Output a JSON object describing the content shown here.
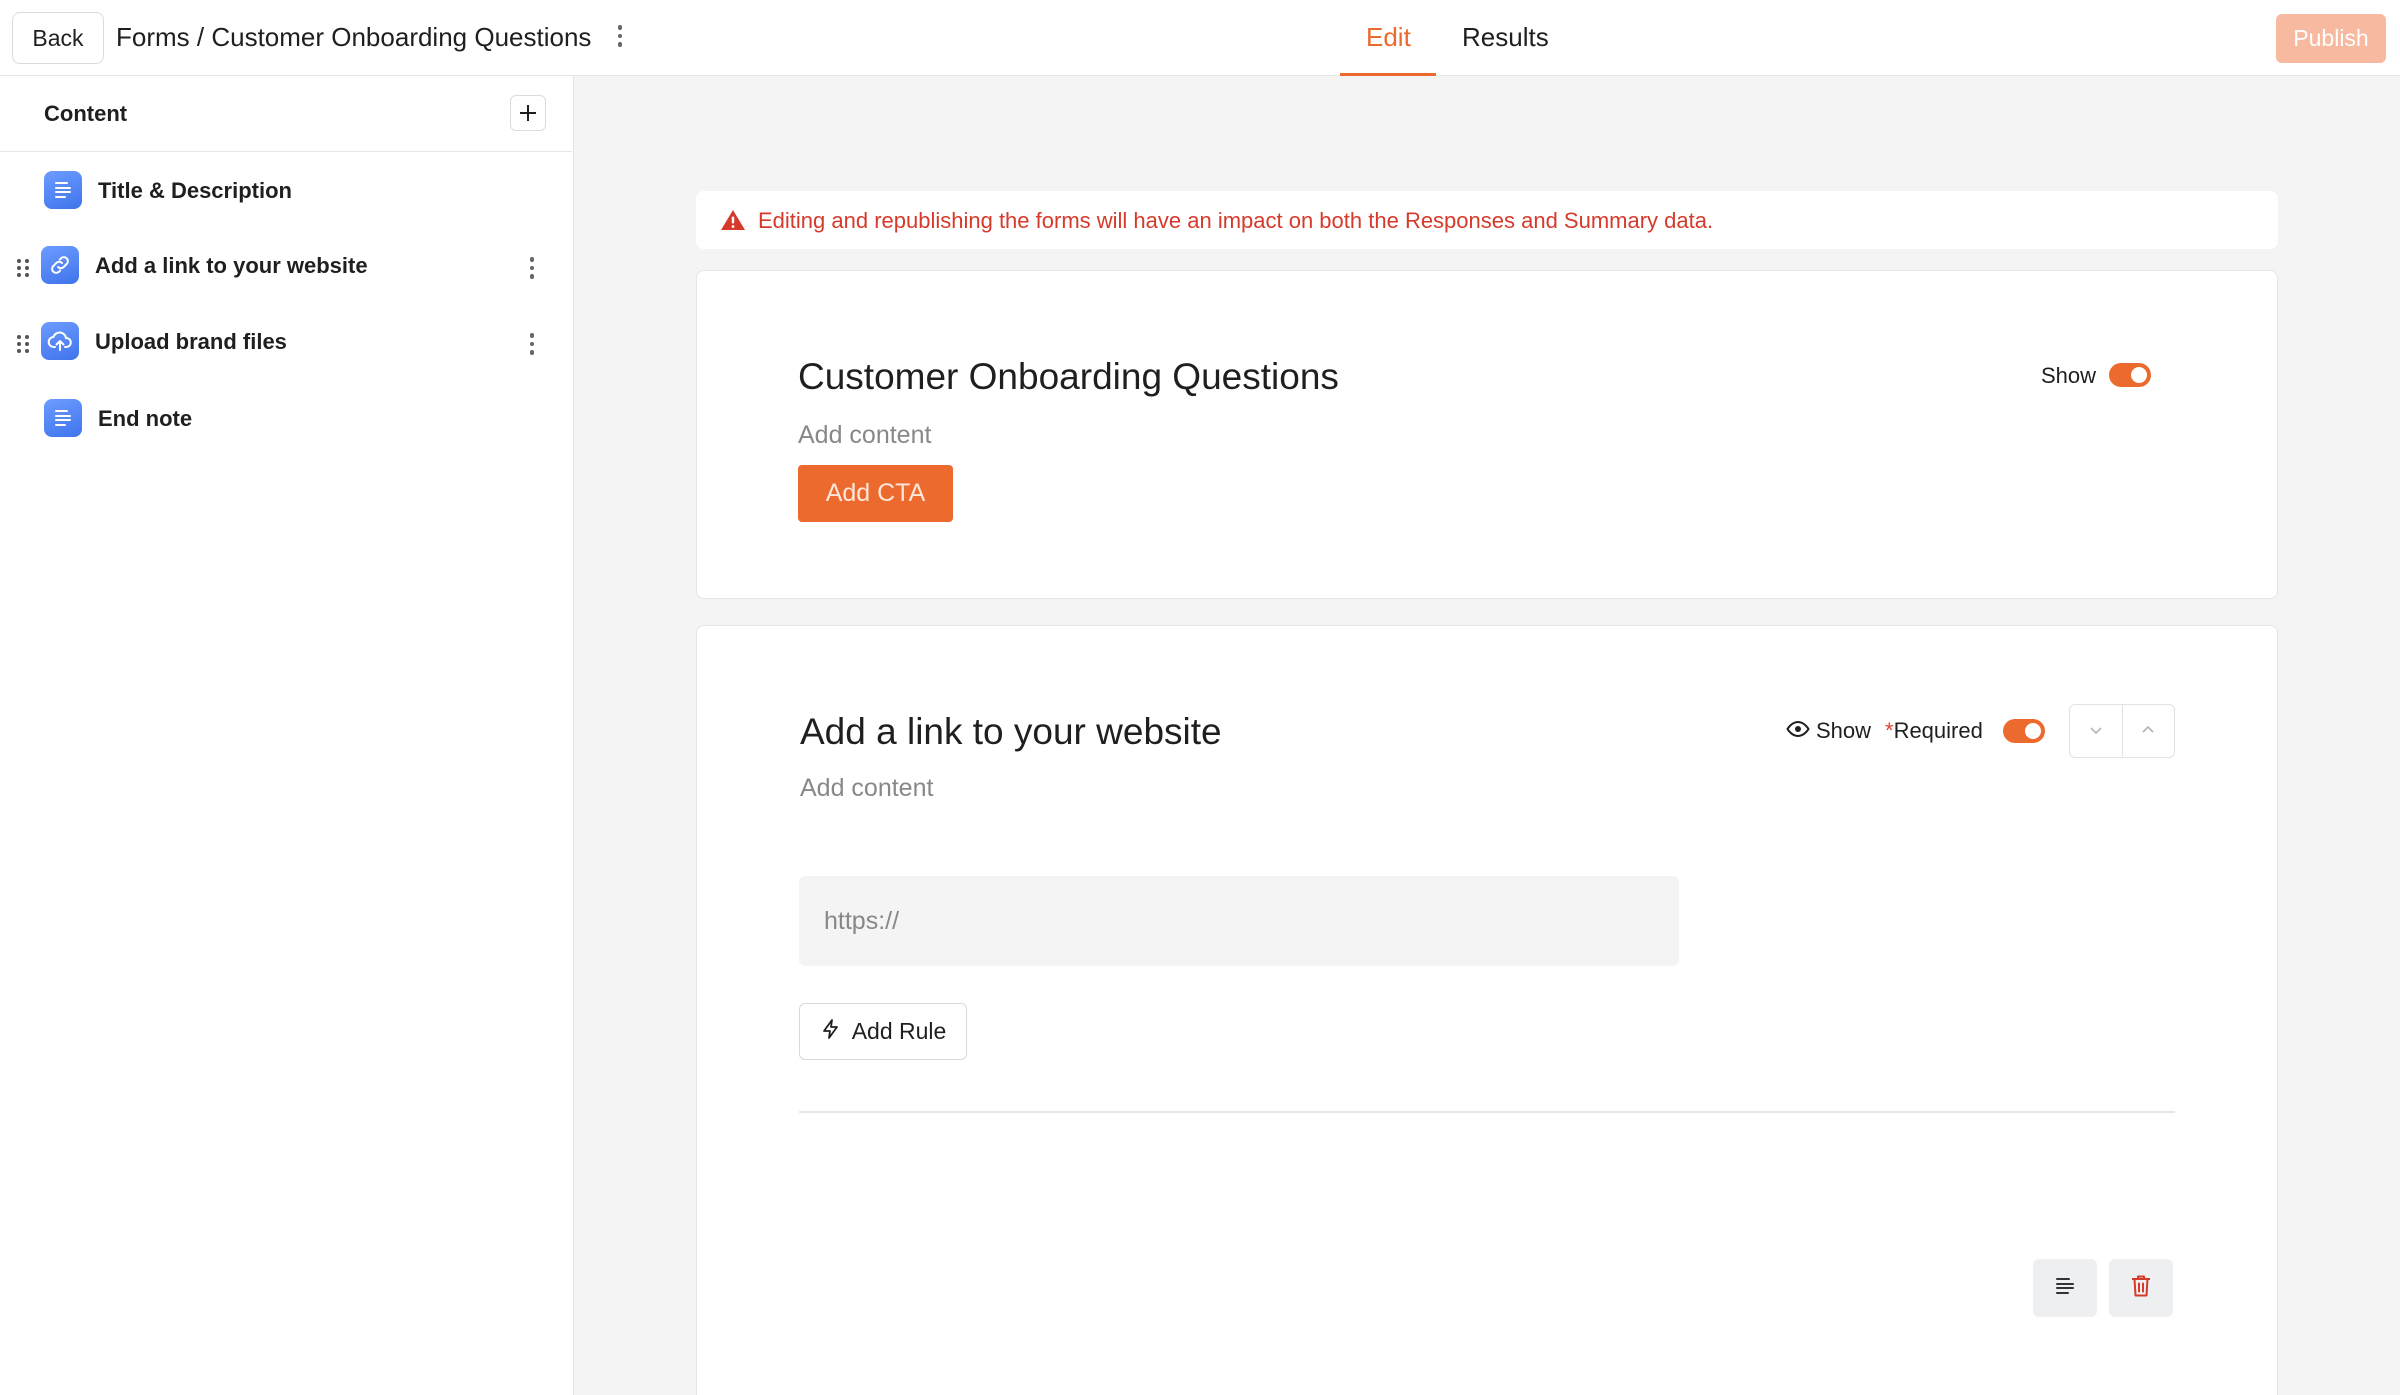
{
  "header": {
    "back_label": "Back",
    "breadcrumb": "Forms / Customer Onboarding Questions",
    "tabs": [
      {
        "label": "Edit",
        "active": true
      },
      {
        "label": "Results",
        "active": false
      }
    ],
    "publish_label": "Publish",
    "accent_color": "#ec6a2e"
  },
  "sidebar": {
    "title": "Content",
    "add_icon": "plus-icon",
    "items": [
      {
        "label": "Title & Description",
        "icon": "text-lines-icon"
      },
      {
        "label": "Add a link to your website",
        "icon": "link-icon"
      },
      {
        "label": "Upload brand files",
        "icon": "cloud-upload-icon"
      },
      {
        "label": "End note",
        "icon": "text-lines-icon"
      }
    ]
  },
  "banner": {
    "icon": "warning-icon",
    "text": "Editing and republishing the forms will have an impact on both the Responses and Summary data."
  },
  "title_card": {
    "title": "Customer Onboarding Questions",
    "subtitle": "Add content",
    "cta_label": "Add CTA",
    "show_label": "Show",
    "show_enabled": true
  },
  "question_card": {
    "title": "Add a link to your website",
    "subtitle": "Add content",
    "show_label": "Show",
    "required_star": "*",
    "required_label": "Required",
    "required_enabled": true,
    "input_placeholder": "https://",
    "add_rule_label": "Add Rule"
  }
}
